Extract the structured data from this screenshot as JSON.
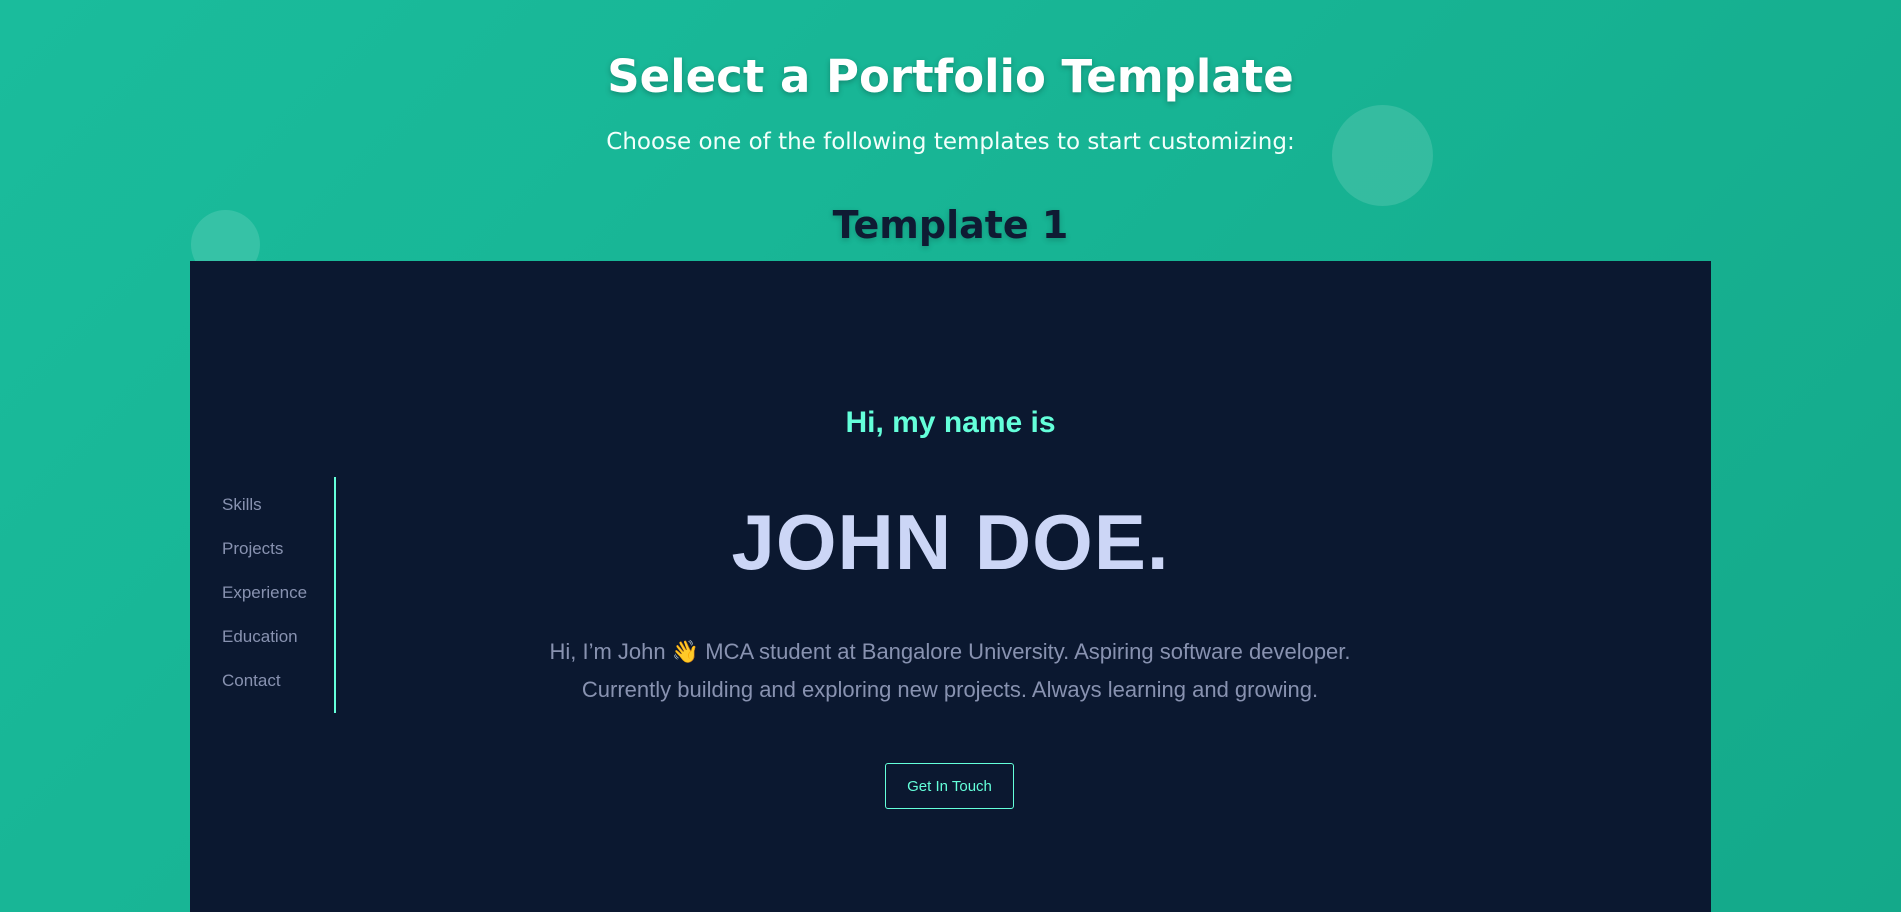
{
  "page": {
    "title": "Select a Portfolio Template",
    "subtitle": "Choose one of the following templates to start customizing:"
  },
  "template": {
    "heading": "Template 1",
    "nav": [
      "Skills",
      "Projects",
      "Experience",
      "Education",
      "Contact"
    ],
    "greeting": "Hi, my name is",
    "name": "JOHN DOE.",
    "bio": "Hi, I’m John 👋 MCA student at Bangalore University. Aspiring software developer. Currently building and exploring new projects. Always learning and growing.",
    "cta_label": "Get In Touch"
  },
  "colors": {
    "background_gradient": [
      "#1abc9c",
      "#14a98a"
    ],
    "preview_bg": "#0b1830",
    "accent": "#64ffda",
    "name_text": "#ccd6f6",
    "muted_text": "#8892b0",
    "template_heading": "#0f1b33"
  }
}
